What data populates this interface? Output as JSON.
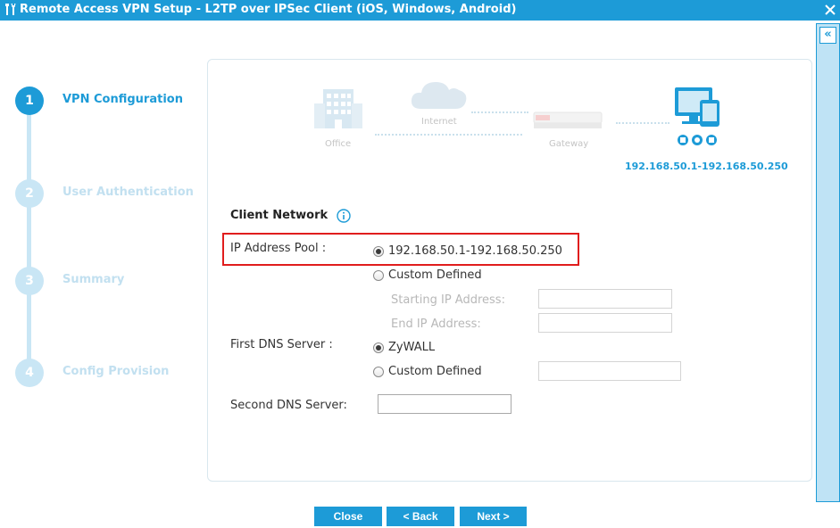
{
  "window": {
    "title": "Remote Access VPN Setup - L2TP over IPSec Client (iOS, Windows, Android)",
    "colors": {
      "accent": "#1d9bd7",
      "highlight": "#e01d1d"
    },
    "icons": {
      "title": "wrench-screwdriver-icon",
      "close": "close-icon",
      "collapse": "double-chevron-left-icon"
    },
    "collapse_label": "«"
  },
  "steps": [
    {
      "number": "1",
      "label": "VPN Configuration",
      "active": true
    },
    {
      "number": "2",
      "label": "User Authentication",
      "active": false
    },
    {
      "number": "3",
      "label": "Summary",
      "active": false
    },
    {
      "number": "4",
      "label": "Config Provision",
      "active": false
    }
  ],
  "diagram": {
    "office_label": "Office",
    "internet_label": "Internet",
    "gateway_label": "Gateway",
    "client_ip_range": "192.168.50.1-192.168.50.250"
  },
  "form": {
    "section_title": "Client Network",
    "ip_pool_label": "IP Address Pool :",
    "ip_pool_option_default": "192.168.50.1-192.168.50.250",
    "ip_pool_option_custom": "Custom Defined",
    "ip_pool_selected": "default",
    "starting_ip_label": "Starting IP Address:",
    "starting_ip_value": "",
    "end_ip_label": "End IP Address:",
    "end_ip_value": "",
    "first_dns_label": "First DNS Server :",
    "first_dns_option_zywall": "ZyWALL",
    "first_dns_option_custom": "Custom Defined",
    "first_dns_selected": "zywall",
    "first_dns_custom_value": "",
    "second_dns_label": "Second DNS Server:",
    "second_dns_value": ""
  },
  "buttons": {
    "close": "Close",
    "back": "< Back",
    "next": "Next >"
  }
}
